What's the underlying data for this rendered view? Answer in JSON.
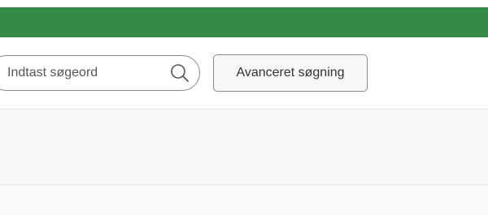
{
  "header": {
    "accent_color": "#348a47"
  },
  "search": {
    "placeholder": "Indtast søgeord",
    "value": "",
    "icon": "search-icon"
  },
  "advanced_search": {
    "label": "Avanceret søgning"
  }
}
